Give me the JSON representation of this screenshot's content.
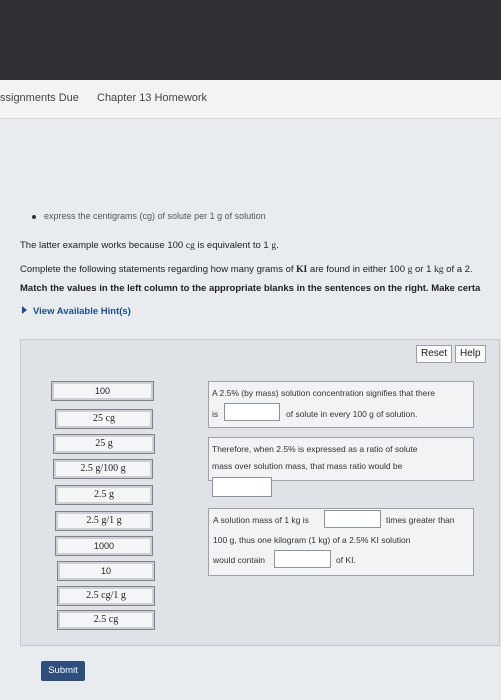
{
  "nav": {
    "assignments_due": "ssignments Due",
    "chapter": "Chapter 13 Homework"
  },
  "intro": {
    "bullet": "express the centigrams (cg) of solute per 1 g of solution",
    "line1_pre": "The latter example works because 100 ",
    "line1_cg": "cg",
    "line1_mid": " is equivalent to 1 ",
    "line1_g": "g",
    "line2_pre": "Complete the following statements regarding how many grams of ",
    "line2_ki": "KI",
    "line2_mid": " are found in either 100 ",
    "line2_g": "g",
    "line2_or": " or 1 ",
    "line2_kg": "kg",
    "line2_post": " of a 2.",
    "line3": "Match the values in the left column to the appropriate blanks in the sentences on the right. Make certa",
    "hint": "View Available Hint(s)"
  },
  "buttons": {
    "reset": "Reset",
    "help": "Help",
    "submit": "Submit"
  },
  "tiles": [
    "100",
    "25 cg",
    "25 g",
    "2.5 g/100 g",
    "2.5 g",
    "2.5 g/1 g",
    "1000",
    "10",
    "2.5 cg/1 g",
    "2.5 cg"
  ],
  "statements": {
    "s1_line1": "A 2.5% (by mass) solution concentration signifies that there",
    "s1_is": "is",
    "s1_line2_post": "of solute in every 100 g of solution.",
    "s2_line1": "Therefore, when 2.5% is expressed as a ratio of solute",
    "s2_line2": "mass over solution mass, that mass ratio would be",
    "s3_line1_pre": "A solution mass of 1 kg is",
    "s3_line1_post": "times greater than",
    "s3_line2": "100 g, thus one kilogram (1 kg) of a 2.5% KI solution",
    "s3_line3_pre": "would contain",
    "s3_line3_post": "of KI."
  }
}
